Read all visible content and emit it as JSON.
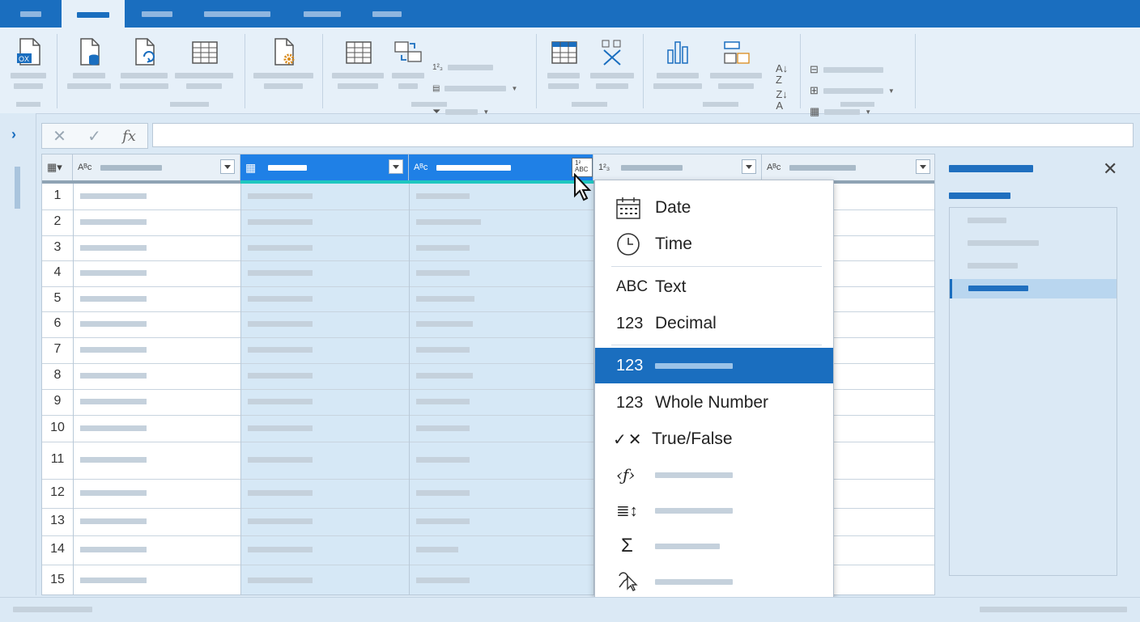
{
  "menu": {
    "items": [
      {
        "icon": "calendar-icon",
        "label": "Date"
      },
      {
        "icon": "clock-icon",
        "label": "Time"
      },
      {
        "icon": "text-type-icon",
        "glyph": "ABC",
        "label": "Text"
      },
      {
        "icon": "decimal-type-icon",
        "glyph": "123",
        "label": "Decimal"
      },
      {
        "icon": "number-type-icon",
        "glyph": "123",
        "label": ""
      },
      {
        "icon": "whole-number-icon",
        "glyph": "123",
        "label": "Whole Number"
      },
      {
        "icon": "true-false-icon",
        "glyph": "✓✕",
        "label": "True/False"
      },
      {
        "icon": "function-icon",
        "label": ""
      },
      {
        "icon": "sort-list-icon",
        "label": ""
      },
      {
        "icon": "sum-icon",
        "glyph": "Σ",
        "label": ""
      },
      {
        "icon": "pointer-select-icon",
        "label": ""
      }
    ]
  },
  "grid": {
    "row_numbers": [
      "1",
      "2",
      "3",
      "4",
      "5",
      "6",
      "7",
      "8",
      "9",
      "10",
      "11",
      "12",
      "13",
      "14",
      "15"
    ],
    "column_type_icons": [
      "Aᴮᴄ",
      "▦",
      "Aᴮᴄ",
      "1²₃",
      "Aᴮᴄ"
    ]
  },
  "formula": {
    "cancel": "✕",
    "confirm": "✓",
    "fx": "fx"
  },
  "colors": {
    "accent": "#1a6ebf",
    "selected_header": "#1f80e6",
    "selected_col": "#d6e8f6"
  }
}
